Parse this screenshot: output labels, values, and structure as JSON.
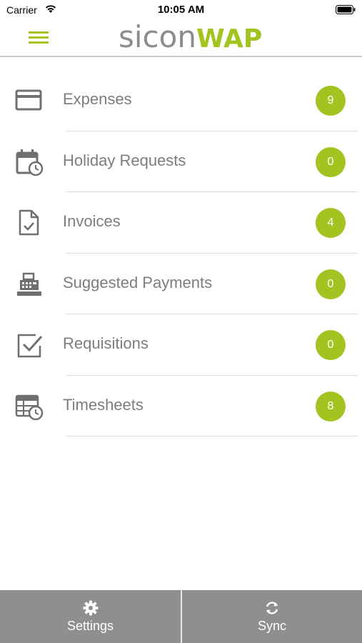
{
  "status_bar": {
    "carrier": "Carrier",
    "time": "10:05 AM"
  },
  "header": {
    "brand_part_a": "sicon",
    "brand_part_b": "WAP",
    "brand_color": "#a3c320"
  },
  "modules": [
    {
      "label": "Expenses",
      "count": "9",
      "icon": "credit-card-icon"
    },
    {
      "label": "Holiday Requests",
      "count": "0",
      "icon": "calendar-clock-icon"
    },
    {
      "label": "Invoices",
      "count": "4",
      "icon": "document-check-icon"
    },
    {
      "label": "Suggested Payments",
      "count": "0",
      "icon": "cash-register-icon"
    },
    {
      "label": "Requisitions",
      "count": "0",
      "icon": "checkbox-icon"
    },
    {
      "label": "Timesheets",
      "count": "8",
      "icon": "table-clock-icon"
    }
  ],
  "bottom_bar": {
    "settings_label": "Settings",
    "sync_label": "Sync"
  }
}
